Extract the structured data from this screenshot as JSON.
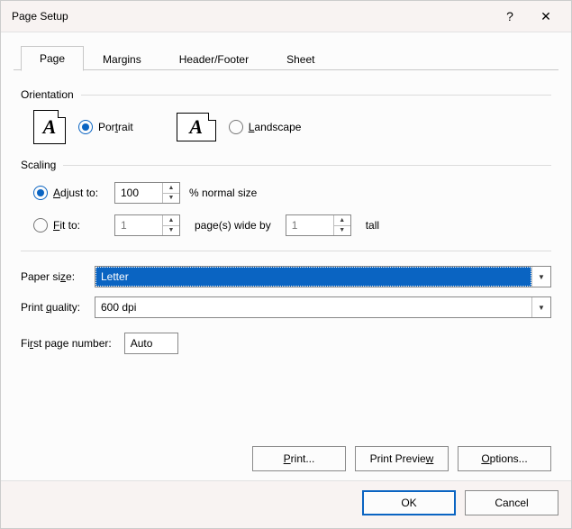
{
  "title": "Page Setup",
  "titlebar": {
    "help": "?",
    "close": "✕"
  },
  "tabs": [
    "Page",
    "Margins",
    "Header/Footer",
    "Sheet"
  ],
  "active_tab": 0,
  "orientation": {
    "group_label": "Orientation",
    "portrait_html": "Por<span class='und'>t</span>rait",
    "landscape_html": "<span class='und'>L</span>andscape",
    "selected": "portrait"
  },
  "scaling": {
    "group_label": "Scaling",
    "adjust_html": "<span class='und'>A</span>djust to:",
    "adjust_value": "100",
    "adjust_suffix": "% normal size",
    "fit_html": "<span class='und'>F</span>it to:",
    "fit_wide_value": "1",
    "fit_middle_text": "page(s) wide by",
    "fit_tall_value": "1",
    "fit_tall_suffix": "tall",
    "selected": "adjust"
  },
  "paper": {
    "size_label_html": "Paper si<span class='und'>z</span>e:",
    "size_value": "Letter",
    "quality_label_html": "Print <span class='und'>q</span>uality:",
    "quality_value": "600 dpi"
  },
  "first_page": {
    "label_html": "Fi<span class='und'>r</span>st page number:",
    "value": "Auto"
  },
  "inner_buttons": {
    "print_html": "<span class='und'>P</span>rint...",
    "preview_html": "Print Previe<span class='und'>w</span>",
    "options_html": "<span class='und'>O</span>ptions..."
  },
  "footer": {
    "ok": "OK",
    "cancel": "Cancel"
  }
}
